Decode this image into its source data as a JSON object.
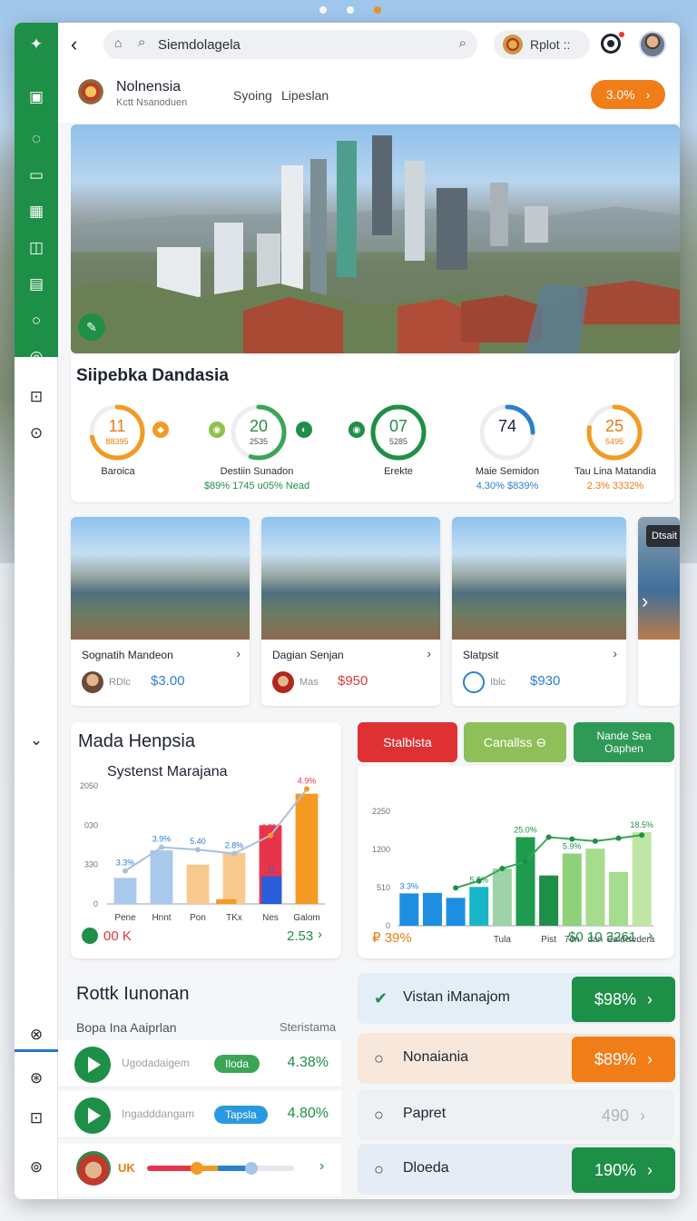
{
  "browser": {
    "search_text": "Siemdolagela",
    "profile_label": "Rplot ::"
  },
  "header": {
    "brand": "Nolnensia",
    "brand_sub": "Kctt Nsanoduen",
    "nav": [
      "Syoing",
      "Lipeslan"
    ],
    "cta_label": "3.0%"
  },
  "stats": {
    "title": "Siipebka Dandasia",
    "gauges": [
      {
        "value": "11",
        "sub": "88395",
        "label": "Baroica",
        "pct": "",
        "color": "#f29b22",
        "fill": 0.72
      },
      {
        "value": "20",
        "sub": "2535",
        "label": "Destiin Sunadon",
        "pct": "$89% 1745 u05% Nead",
        "color": "#3aa655",
        "fill": 0.55
      },
      {
        "value": "07",
        "sub": "5285",
        "label": "Erekte",
        "pct": "",
        "color": "#1e8f47",
        "fill": 1.0
      },
      {
        "value": "74",
        "sub": "",
        "label": "Maie Semidon",
        "pct": "4.30% $839%",
        "color": "#2b7fd0",
        "fill": 0.25
      },
      {
        "value": "25",
        "sub": "5495",
        "label": "Tau Lina Matandia",
        "pct": "2.3% 3332%",
        "color": "#f29b22",
        "fill": 0.78
      }
    ]
  },
  "cards": [
    {
      "title": "Sognatih Mandeon",
      "role": "RDlc",
      "price": "$3.00",
      "price_color": "#2b7fd0"
    },
    {
      "title": "Dagian Senjan",
      "role": "Mas",
      "price": "$950",
      "price_color": "#d93a36"
    },
    {
      "title": "Slatpsit",
      "role": "Iblc",
      "price": "$930",
      "price_color": "#2b7fd0"
    }
  ],
  "card_peek_label": "Dtsait",
  "left_chart": {
    "title": "Mada Henpsia",
    "subtitle": "Systenst Marajana",
    "footer_left": "00 K",
    "footer_right": "2.53"
  },
  "right_tabs": [
    "Stalblsta",
    "Canallss ⊖",
    "Nande Sea Oaphen"
  ],
  "right_chart": {
    "footer_left": "₽ 39%",
    "footer_right": "$0 10 3261"
  },
  "chart_data": [
    {
      "type": "bar",
      "title": "Systenst Marajana",
      "categories": [
        "Pene",
        "Hnnt",
        "Pon",
        "TKx",
        "Nes",
        "Galom"
      ],
      "ytick_labels": [
        "0",
        "330",
        "030",
        "2050"
      ],
      "values": [
        330,
        680,
        500,
        650,
        1000,
        1400
      ],
      "series_colors": [
        "#a9c9ec",
        "#a9c9ec",
        "#f7c98d",
        "#f7c98d",
        "#e8344a",
        "#f59b23"
      ],
      "line_values": [
        420,
        720,
        690,
        640,
        870,
        1460
      ],
      "data_labels": [
        "3.3%",
        "3.9%",
        "5.40",
        "2.8%",
        "4.9%",
        "4.9%"
      ],
      "extra_bars": [
        {
          "category": "Nes",
          "value": 350,
          "color": "#2a5ddb",
          "label": "11"
        },
        {
          "category": "TKx",
          "value": 60,
          "color": "#f59b23"
        }
      ],
      "ylim": [
        0,
        1500
      ]
    },
    {
      "type": "bar",
      "title": "",
      "categories": [
        "",
        "",
        "",
        "Tula",
        "",
        "Pist",
        "7on",
        "dan",
        "Ealde",
        "tedera"
      ],
      "ytick_labels": [
        "0",
        "510",
        "1200",
        "2250"
      ],
      "values": [
        650,
        660,
        560,
        780,
        1150,
        1780,
        1010,
        1450,
        1550,
        1080,
        1880
      ],
      "colors": [
        "#1e8fe0",
        "#1e8fe0",
        "#1e8fe0",
        "#18b6c6",
        "#9ed3a8",
        "#1e9b4e",
        "#1e8f47",
        "#8fd07a",
        "#a5dc8e",
        "#a5dc8e",
        "#bfe6a5"
      ],
      "line_values": [
        760,
        900,
        1150,
        1290,
        1780,
        1740,
        1700,
        1760,
        1820
      ],
      "data_labels": [
        "3.3%",
        "5.9%",
        "25.0%",
        "5.9%",
        "18.5%"
      ],
      "ylim": [
        0,
        2300
      ]
    }
  ],
  "rotation": {
    "title": "Rottk Iunonan",
    "subtitle": "Bopa Ina Aaiprlan",
    "right_label": "Steristama",
    "rows": [
      {
        "name": "Ugodadaigem",
        "tag": "Iloda",
        "tag_color": "#3aa655",
        "value": "4.38%"
      },
      {
        "name": "Ingadddangam",
        "tag": "Tapsla",
        "tag_color": "#2a9ae0",
        "value": "4.80%"
      }
    ],
    "progress_label": "UK"
  },
  "side_list": [
    {
      "label": "Vistan iManajom",
      "value": "$98%",
      "bg": "#e4eef7",
      "btn": "#1e8f47"
    },
    {
      "label": "Nonaiania",
      "value": "$89%",
      "bg": "#f8e8db",
      "btn": "#f07d18"
    },
    {
      "label": "Papret",
      "value": "490",
      "bg": "#eef0f3",
      "btn": ""
    },
    {
      "label": "Dloeda",
      "value": "190%",
      "bg": "#e6ecf3",
      "btn": "#1e8f47"
    }
  ]
}
